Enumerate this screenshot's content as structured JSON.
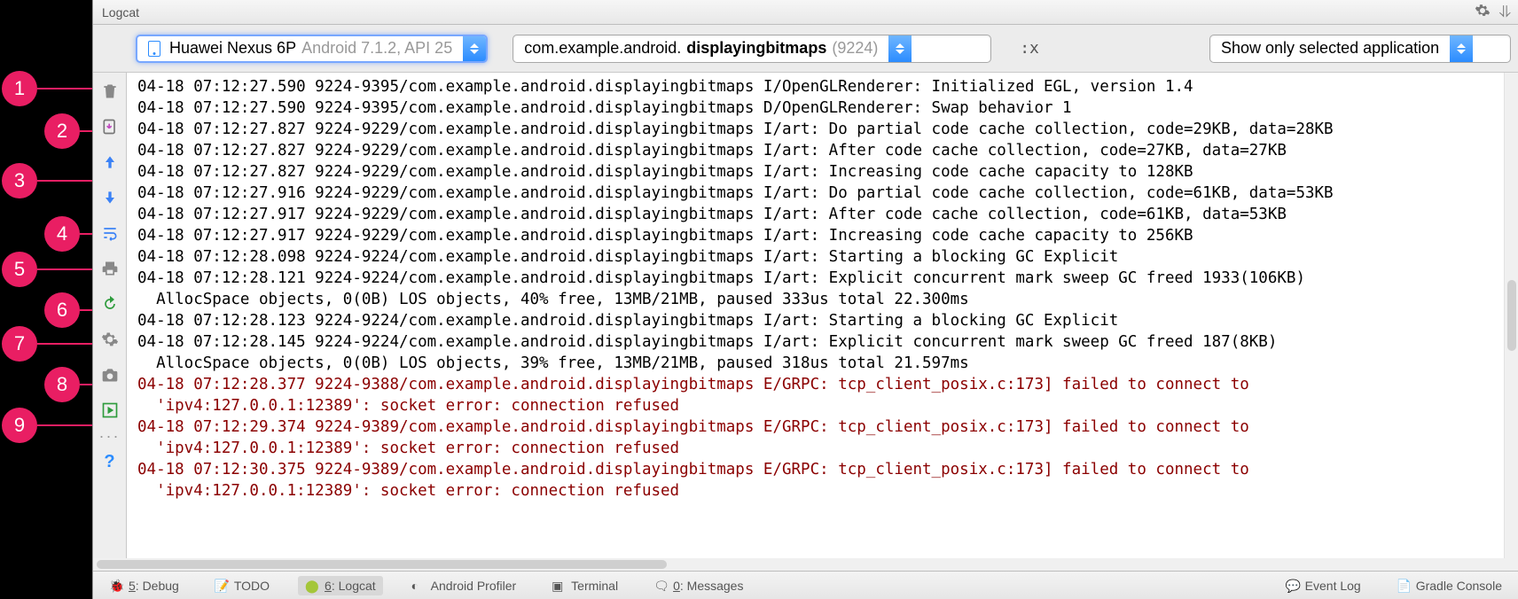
{
  "title": "Logcat",
  "callouts": [
    "1",
    "2",
    "3",
    "4",
    "5",
    "6",
    "7",
    "8",
    "9"
  ],
  "filters": {
    "device_name": "Huawei Nexus 6P",
    "device_sub": "Android 7.1.2, API 25",
    "process_pkg": "com.example.android.",
    "process_bold": "displayingbitmaps",
    "process_pid": " (9224)",
    "regex_hint": ":x",
    "scope": "Show only selected application"
  },
  "toolbar_icons": [
    "trash",
    "scroll-to-end",
    "arrow-up",
    "arrow-down",
    "soft-wrap",
    "print",
    "restart",
    "settings",
    "camera",
    "record",
    "more",
    "help"
  ],
  "log_lines": [
    {
      "level": "I",
      "text": "04-18 07:12:27.590 9224-9395/com.example.android.displayingbitmaps I/OpenGLRenderer: Initialized EGL, version 1.4"
    },
    {
      "level": "D",
      "text": "04-18 07:12:27.590 9224-9395/com.example.android.displayingbitmaps D/OpenGLRenderer: Swap behavior 1"
    },
    {
      "level": "I",
      "text": "04-18 07:12:27.827 9224-9229/com.example.android.displayingbitmaps I/art: Do partial code cache collection, code=29KB, data=28KB"
    },
    {
      "level": "I",
      "text": "04-18 07:12:27.827 9224-9229/com.example.android.displayingbitmaps I/art: After code cache collection, code=27KB, data=27KB"
    },
    {
      "level": "I",
      "text": "04-18 07:12:27.827 9224-9229/com.example.android.displayingbitmaps I/art: Increasing code cache capacity to 128KB"
    },
    {
      "level": "I",
      "text": "04-18 07:12:27.916 9224-9229/com.example.android.displayingbitmaps I/art: Do partial code cache collection, code=61KB, data=53KB"
    },
    {
      "level": "I",
      "text": "04-18 07:12:27.917 9224-9229/com.example.android.displayingbitmaps I/art: After code cache collection, code=61KB, data=53KB"
    },
    {
      "level": "I",
      "text": "04-18 07:12:27.917 9224-9229/com.example.android.displayingbitmaps I/art: Increasing code cache capacity to 256KB"
    },
    {
      "level": "I",
      "text": "04-18 07:12:28.098 9224-9224/com.example.android.displayingbitmaps I/art: Starting a blocking GC Explicit"
    },
    {
      "level": "I",
      "text": "04-18 07:12:28.121 9224-9224/com.example.android.displayingbitmaps I/art: Explicit concurrent mark sweep GC freed 1933(106KB)"
    },
    {
      "level": "I",
      "text": "  AllocSpace objects, 0(0B) LOS objects, 40% free, 13MB/21MB, paused 333us total 22.300ms"
    },
    {
      "level": "I",
      "text": "04-18 07:12:28.123 9224-9224/com.example.android.displayingbitmaps I/art: Starting a blocking GC Explicit"
    },
    {
      "level": "I",
      "text": "04-18 07:12:28.145 9224-9224/com.example.android.displayingbitmaps I/art: Explicit concurrent mark sweep GC freed 187(8KB)"
    },
    {
      "level": "I",
      "text": "  AllocSpace objects, 0(0B) LOS objects, 39% free, 13MB/21MB, paused 318us total 21.597ms"
    },
    {
      "level": "E",
      "text": "04-18 07:12:28.377 9224-9388/com.example.android.displayingbitmaps E/GRPC: tcp_client_posix.c:173] failed to connect to"
    },
    {
      "level": "E",
      "text": "  'ipv4:127.0.0.1:12389': socket error: connection refused"
    },
    {
      "level": "E",
      "text": "04-18 07:12:29.374 9224-9389/com.example.android.displayingbitmaps E/GRPC: tcp_client_posix.c:173] failed to connect to"
    },
    {
      "level": "E",
      "text": "  'ipv4:127.0.0.1:12389': socket error: connection refused"
    },
    {
      "level": "E",
      "text": "04-18 07:12:30.375 9224-9389/com.example.android.displayingbitmaps E/GRPC: tcp_client_posix.c:173] failed to connect to"
    },
    {
      "level": "E",
      "text": "  'ipv4:127.0.0.1:12389': socket error: connection refused"
    }
  ],
  "bottom_tabs": {
    "debug_num": "5",
    "debug_label": ": Debug",
    "todo": "TODO",
    "logcat_num": "6",
    "logcat_label": ": Logcat",
    "profiler": "Android Profiler",
    "terminal": "Terminal",
    "messages_num": "0",
    "messages_label": ": Messages",
    "event_log": "Event Log",
    "gradle": "Gradle Console"
  }
}
